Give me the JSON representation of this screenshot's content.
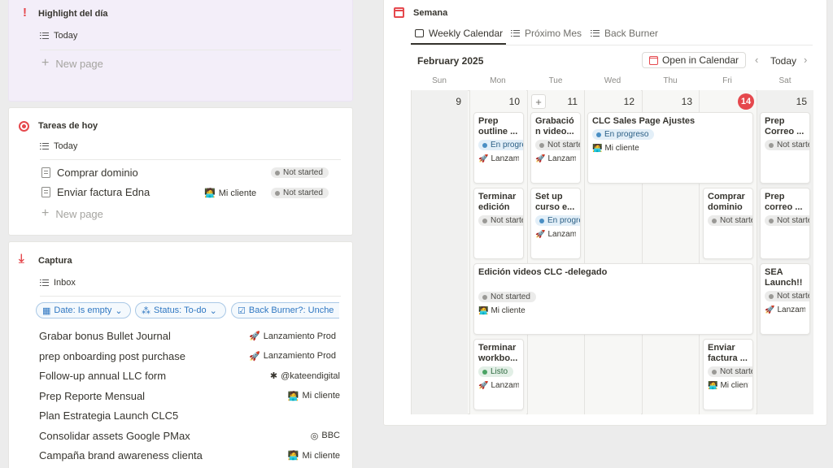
{
  "highlight": {
    "icon": "exclamation-icon",
    "title": "Highlight del día",
    "view": "Today",
    "new_page": "New page"
  },
  "tareas": {
    "icon": "target-icon",
    "title": "Tareas de hoy",
    "view": "Today",
    "rows": [
      {
        "title": "Comprar dominio",
        "client": "",
        "status": "Not started"
      },
      {
        "title": "Enviar factura Edna",
        "client": "Mi cliente",
        "status": "Not started"
      }
    ],
    "new_page": "New page"
  },
  "captura": {
    "icon": "download-icon",
    "title": "Captura",
    "view": "Inbox",
    "filters": [
      "Date: Is empty",
      "Status: To-do",
      "Back Burner?: Unche"
    ],
    "rows": [
      {
        "title": "Grabar bonus Bullet Journal",
        "tag": "Lanzamiento Prod",
        "tag_icon": "rocket-icon"
      },
      {
        "title": "prep onboarding post purchase",
        "tag": "Lanzamiento Prod",
        "tag_icon": "rocket-icon"
      },
      {
        "title": "Follow-up annual LLC form",
        "tag": "@kateendigital",
        "tag_icon": "asterisk-icon"
      },
      {
        "title": "Prep Reporte Mensual",
        "tag": "Mi cliente",
        "tag_icon": "person-laptop-icon"
      },
      {
        "title": "Plan Estrategia Launch CLC5",
        "tag": "",
        "tag_icon": ""
      },
      {
        "title": "Consolidar assets Google PMax",
        "tag": "BBC",
        "tag_icon": "target-icon"
      },
      {
        "title": "Campaña brand awareness clienta",
        "tag": "Mi cliente",
        "tag_icon": "person-laptop-icon"
      }
    ]
  },
  "semana": {
    "icon": "calendar-icon",
    "title": "Semana",
    "tabs": [
      "Weekly Calendar",
      "Próximo Mes",
      "Back Burner"
    ],
    "month": "February 2025",
    "open_in_calendar": "Open in Calendar",
    "today_btn": "Today",
    "days": [
      "Sun",
      "Mon",
      "Tue",
      "Wed",
      "Thu",
      "Fri",
      "Sat"
    ],
    "dates": [
      "9",
      "10",
      "11",
      "12",
      "13",
      "14",
      "15"
    ],
    "today_index": 5,
    "cards": {
      "mon1": {
        "title": "Prep outline ...",
        "status": "En progreso",
        "tag": "Lanzamiento"
      },
      "tue1": {
        "title": "Grabació n video...",
        "status": "Not started",
        "tag": "Lanzamiento"
      },
      "wed1": {
        "title": "CLC Sales Page Ajustes",
        "status": "En progreso",
        "tag": "Mi cliente"
      },
      "sat1": {
        "title": "Prep Correo ...",
        "status": "Not started",
        "tag": ""
      },
      "mon2": {
        "title": "Terminar edición ...",
        "status": "Not started",
        "tag": ""
      },
      "tue2": {
        "title": "Set up curso e...",
        "status": "En progreso",
        "tag": "Lanzamiento"
      },
      "fri2": {
        "title": "Comprar dominio",
        "status": "Not started",
        "tag": ""
      },
      "sat2": {
        "title": "Prep correo ...",
        "status": "Not started",
        "tag": ""
      },
      "mon3": {
        "title": "Edición videos CLC -delegado",
        "status": "Not started",
        "tag": "Mi cliente"
      },
      "sat3": {
        "title": "SEA Launch!!!",
        "status": "Not started",
        "tag": "Lanzamiento"
      },
      "mon4": {
        "title": "Terminar workbo...",
        "status": "Listo",
        "tag": "Lanzamiento"
      },
      "fri4": {
        "title": "Enviar factura ...",
        "status": "Not started",
        "tag": "Mi cliente"
      }
    }
  },
  "colors": {
    "accent_red": "#e5484d",
    "filter_blue": "#2f77c2",
    "highlight_bg": "#f3eef9"
  }
}
